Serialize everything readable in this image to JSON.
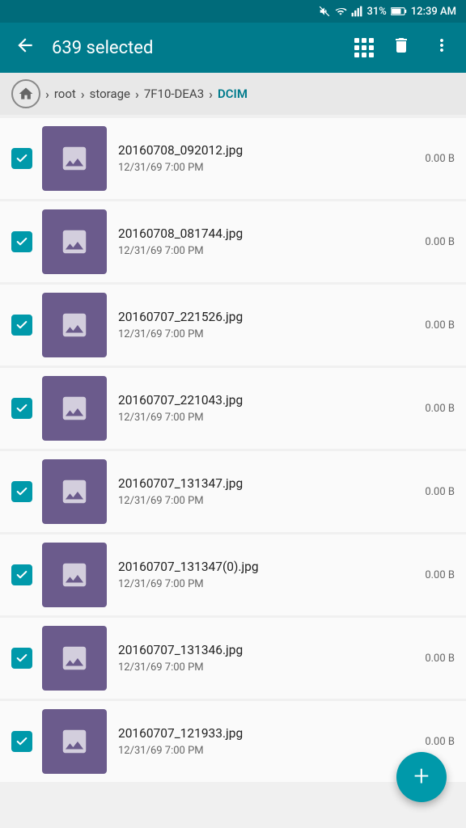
{
  "statusBar": {
    "battery": "31%",
    "time": "12:39 AM"
  },
  "appBar": {
    "title": "639 selected",
    "backLabel": "←",
    "deleteLabel": "🗑",
    "moreLabel": "⋮"
  },
  "breadcrumb": {
    "separator": ">",
    "parts": [
      "root",
      "storage",
      "7F10-DEA3"
    ],
    "active": "DCIM"
  },
  "files": [
    {
      "name": "20160708_092012.jpg",
      "date": "12/31/69 7:00 PM",
      "size": "0.00 B",
      "checked": true
    },
    {
      "name": "20160708_081744.jpg",
      "date": "12/31/69 7:00 PM",
      "size": "0.00 B",
      "checked": true
    },
    {
      "name": "20160707_221526.jpg",
      "date": "12/31/69 7:00 PM",
      "size": "0.00 B",
      "checked": true
    },
    {
      "name": "20160707_221043.jpg",
      "date": "12/31/69 7:00 PM",
      "size": "0.00 B",
      "checked": true
    },
    {
      "name": "20160707_131347.jpg",
      "date": "12/31/69 7:00 PM",
      "size": "0.00 B",
      "checked": true
    },
    {
      "name": "20160707_131347(0).jpg",
      "date": "12/31/69 7:00 PM",
      "size": "0.00 B",
      "checked": true
    },
    {
      "name": "20160707_131346.jpg",
      "date": "12/31/69 7:00 PM",
      "size": "0.00 B",
      "checked": true
    },
    {
      "name": "20160707_121933.jpg",
      "date": "12/31/69 7:00 PM",
      "size": "0.00 B",
      "checked": true
    }
  ],
  "fab": {
    "label": "+"
  }
}
